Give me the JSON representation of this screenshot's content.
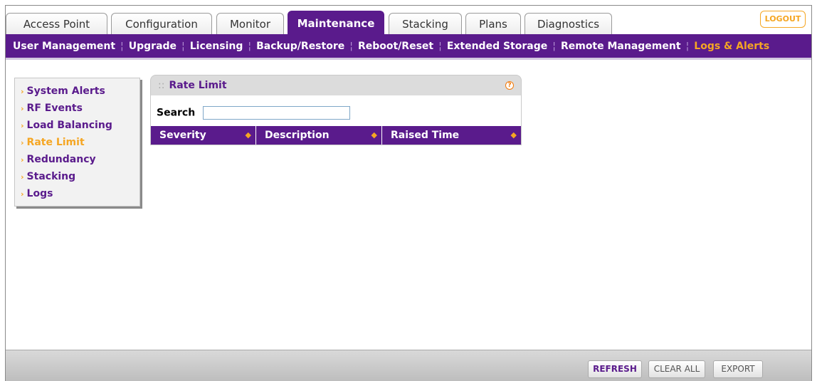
{
  "top_tabs": [
    {
      "label": "Access Point"
    },
    {
      "label": "Configuration"
    },
    {
      "label": "Monitor"
    },
    {
      "label": "Maintenance"
    },
    {
      "label": "Stacking"
    },
    {
      "label": "Plans"
    },
    {
      "label": "Diagnostics"
    }
  ],
  "active_tab": "Maintenance",
  "logout_label": "LOGOUT",
  "sub_nav": [
    {
      "label": "User Management"
    },
    {
      "label": "Upgrade"
    },
    {
      "label": "Licensing"
    },
    {
      "label": "Backup/Restore"
    },
    {
      "label": "Reboot/Reset"
    },
    {
      "label": "Extended Storage"
    },
    {
      "label": "Remote Management"
    },
    {
      "label": "Logs & Alerts"
    }
  ],
  "left_menu": [
    {
      "label": "System Alerts"
    },
    {
      "label": "RF Events"
    },
    {
      "label": "Load Balancing"
    },
    {
      "label": "Rate Limit"
    },
    {
      "label": "Redundancy"
    },
    {
      "label": "Stacking"
    },
    {
      "label": "Logs"
    }
  ],
  "panel": {
    "title": "Rate Limit",
    "help_icon": "?",
    "search_label": "Search",
    "search_value": "",
    "columns": [
      {
        "label": "Severity"
      },
      {
        "label": "Description"
      },
      {
        "label": "Raised Time"
      }
    ]
  },
  "footer": {
    "refresh_label": "REFRESH",
    "clear_all_label": "CLEAR ALL",
    "export_label": "EXPORT"
  },
  "colors": {
    "brand_purple": "#5a1b8c",
    "accent_orange": "#f5a623"
  }
}
